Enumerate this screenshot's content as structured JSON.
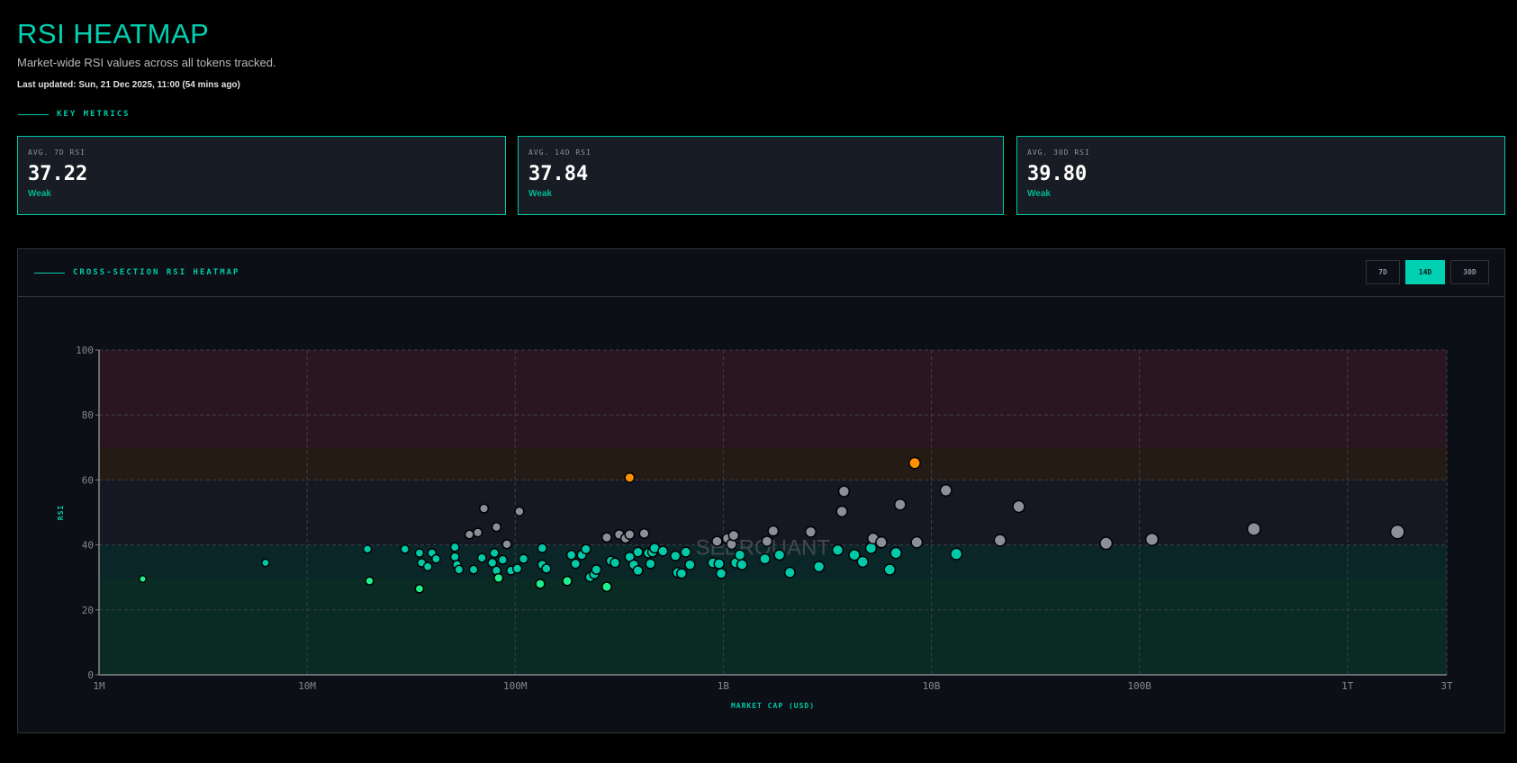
{
  "header": {
    "title": "RSI HEATMAP",
    "subtitle": "Market-wide RSI values across all tokens tracked.",
    "last_updated": "Last updated: Sun, 21 Dec 2025, 11:00 (54 mins ago)"
  },
  "key_metrics": {
    "label": "KEY METRICS",
    "cards": [
      {
        "label": "AVG. 7D RSI",
        "value": "37.22",
        "status": "Weak"
      },
      {
        "label": "AVG. 14D RSI",
        "value": "37.84",
        "status": "Weak"
      },
      {
        "label": "AVG. 30D RSI",
        "value": "39.80",
        "status": "Weak"
      }
    ]
  },
  "heatmap": {
    "label": "CROSS-SECTION RSI HEATMAP",
    "timeframes": [
      {
        "label": "7D",
        "active": false
      },
      {
        "label": "14D",
        "active": true
      },
      {
        "label": "30D",
        "active": false
      }
    ],
    "watermark": "SEERQUANT"
  },
  "colors": {
    "accent": "#00d1b2",
    "oversold": "#1ef08c",
    "weak": "#00c9a7",
    "neutral": "#8a8f99",
    "strong": "#ff9100"
  },
  "chart_data": {
    "type": "scatter",
    "xlabel": "MARKET CAP (USD)",
    "ylabel": "RSI",
    "x_scale": "log10",
    "x_values_are_log10_market_cap": true,
    "xlim_log10": [
      6,
      12.477
    ],
    "ylim": [
      0,
      100
    ],
    "x_ticks": [
      {
        "v": 6,
        "label": "1M"
      },
      {
        "v": 7,
        "label": "10M"
      },
      {
        "v": 8,
        "label": "100M"
      },
      {
        "v": 9,
        "label": "1B"
      },
      {
        "v": 10,
        "label": "10B"
      },
      {
        "v": 11,
        "label": "100B"
      },
      {
        "v": 12,
        "label": "1T"
      },
      {
        "v": 12.477,
        "label": "3T"
      }
    ],
    "y_ticks": [
      0,
      20,
      40,
      60,
      80,
      100
    ],
    "zones": [
      {
        "from": 0,
        "to": 30,
        "color": "#0a2a24"
      },
      {
        "from": 30,
        "to": 40,
        "color": "#0b2629"
      },
      {
        "from": 40,
        "to": 60,
        "color": "#151823"
      },
      {
        "from": 60,
        "to": 70,
        "color": "#241c14"
      },
      {
        "from": 70,
        "to": 100,
        "color": "#2a1620"
      }
    ],
    "grid": true,
    "points": [
      [
        6.21,
        29.5
      ],
      [
        6.8,
        34.5
      ],
      [
        7.29,
        38.7
      ],
      [
        7.3,
        28.9
      ],
      [
        7.47,
        38.7
      ],
      [
        7.54,
        37.5
      ],
      [
        7.54,
        26.5
      ],
      [
        7.55,
        34.5
      ],
      [
        7.58,
        33.3
      ],
      [
        7.6,
        37.5
      ],
      [
        7.62,
        35.7
      ],
      [
        7.71,
        39.3
      ],
      [
        7.71,
        36.3
      ],
      [
        7.72,
        33.9
      ],
      [
        7.73,
        32.4
      ],
      [
        7.78,
        43.2
      ],
      [
        7.8,
        32.4
      ],
      [
        7.82,
        43.8
      ],
      [
        7.84,
        36
      ],
      [
        7.85,
        51.2
      ],
      [
        7.89,
        34.5
      ],
      [
        7.9,
        37.5
      ],
      [
        7.91,
        45.5
      ],
      [
        7.91,
        32.1
      ],
      [
        7.92,
        29.8
      ],
      [
        7.94,
        35.4
      ],
      [
        7.96,
        40.2
      ],
      [
        7.98,
        32.1
      ],
      [
        8.01,
        32.7
      ],
      [
        8.02,
        50.3
      ],
      [
        8.04,
        35.7
      ],
      [
        8.12,
        28
      ],
      [
        8.13,
        33.9
      ],
      [
        8.13,
        39
      ],
      [
        8.15,
        32.7
      ],
      [
        8.25,
        28.9
      ],
      [
        8.27,
        36.9
      ],
      [
        8.29,
        34.2
      ],
      [
        8.32,
        36.9
      ],
      [
        8.34,
        38.7
      ],
      [
        8.36,
        30.1
      ],
      [
        8.38,
        31
      ],
      [
        8.39,
        32.4
      ],
      [
        8.44,
        42.3
      ],
      [
        8.44,
        27.1
      ],
      [
        8.46,
        35.1
      ],
      [
        8.48,
        34.5
      ],
      [
        8.5,
        43.2
      ],
      [
        8.53,
        42
      ],
      [
        8.55,
        60.7
      ],
      [
        8.55,
        36.3
      ],
      [
        8.55,
        43.2
      ],
      [
        8.57,
        33.9
      ],
      [
        8.59,
        37.8
      ],
      [
        8.59,
        32.1
      ],
      [
        8.62,
        43.5
      ],
      [
        8.64,
        37.5
      ],
      [
        8.65,
        34.2
      ],
      [
        8.66,
        37.8
      ],
      [
        8.67,
        39
      ],
      [
        8.71,
        38.1
      ],
      [
        8.77,
        36.6
      ],
      [
        8.78,
        31.5
      ],
      [
        8.8,
        31.2
      ],
      [
        8.82,
        37.8
      ],
      [
        8.84,
        33.9
      ],
      [
        8.95,
        34.5
      ],
      [
        8.97,
        41.1
      ],
      [
        8.98,
        34.2
      ],
      [
        8.99,
        31.2
      ],
      [
        9.02,
        42
      ],
      [
        9.04,
        40.2
      ],
      [
        9.05,
        42.9
      ],
      [
        9.06,
        34.5
      ],
      [
        9.08,
        36.9
      ],
      [
        9.09,
        33.9
      ],
      [
        9.2,
        35.7
      ],
      [
        9.21,
        41.1
      ],
      [
        9.24,
        44.3
      ],
      [
        9.27,
        36.9
      ],
      [
        9.32,
        31.5
      ],
      [
        9.42,
        44
      ],
      [
        9.46,
        33.3
      ],
      [
        9.55,
        38.4
      ],
      [
        9.57,
        50.3
      ],
      [
        9.58,
        56.5
      ],
      [
        9.63,
        36.9
      ],
      [
        9.67,
        34.8
      ],
      [
        9.71,
        39
      ],
      [
        9.72,
        42
      ],
      [
        9.76,
        40.8
      ],
      [
        9.8,
        32.4
      ],
      [
        9.83,
        37.5
      ],
      [
        9.85,
        52.4
      ],
      [
        9.92,
        65.2
      ],
      [
        9.93,
        40.8
      ],
      [
        10.07,
        56.8
      ],
      [
        10.12,
        37.2
      ],
      [
        10.33,
        41.4
      ],
      [
        10.42,
        51.8
      ],
      [
        10.84,
        40.5
      ],
      [
        11.06,
        41.7
      ],
      [
        11.55,
        44.9
      ],
      [
        12.24,
        44
      ]
    ]
  }
}
